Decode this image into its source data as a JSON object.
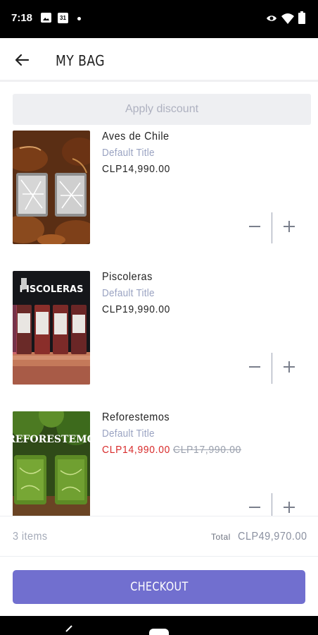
{
  "status_bar": {
    "time": "7:18",
    "calendar_day": "31"
  },
  "header": {
    "title": "MY BAG"
  },
  "discount": {
    "label": "Apply discount"
  },
  "items": [
    {
      "name": "Aves de Chile",
      "variant": "Default Title",
      "price": "CLP14,990.00",
      "image": "aves-de-chile-glasses"
    },
    {
      "name": "Piscoleras",
      "variant": "Default Title",
      "price": "CLP19,990.00",
      "image": "piscoleras-glasses"
    },
    {
      "name": "Reforestemos",
      "variant": "Default Title",
      "price": "CLP14,990.00",
      "compare_price": "CLP17,990.00",
      "image": "reforestemos-glasses"
    }
  ],
  "summary": {
    "items_count": "3 items",
    "total_label": "Total",
    "total_value": "CLP49,970.00"
  },
  "checkout": {
    "label": "CHECKOUT"
  },
  "colors": {
    "accent": "#716fcf",
    "sale": "#d82b2b",
    "muted": "#9aa3c2"
  }
}
